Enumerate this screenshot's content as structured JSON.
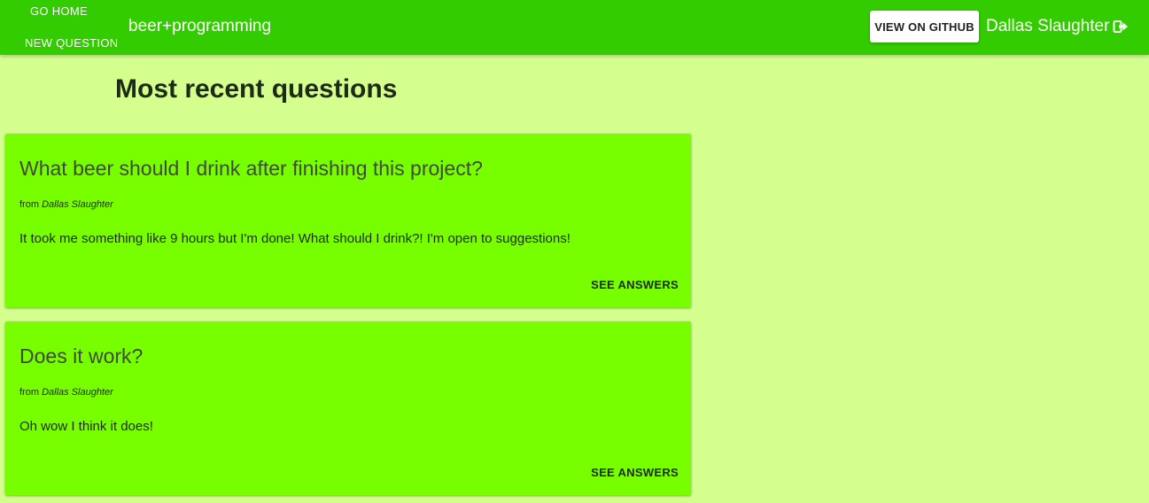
{
  "nav": {
    "home_label": "GO HOME",
    "new_question_label": "NEW QUESTION",
    "brand": "beer+programming",
    "github_label": "VIEW ON GITHUB",
    "user_name": "Dallas Slaughter",
    "logout_icon": "sign-out-icon"
  },
  "page": {
    "heading": "Most recent questions"
  },
  "questions": [
    {
      "title": "What beer should I drink after finishing this project?",
      "from_prefix": "from",
      "author": "Dallas Slaughter",
      "body": "It took me something like 9 hours but I'm done! What should I drink?! I'm open to suggestions!",
      "action_label": "SEE ANSWERS"
    },
    {
      "title": "Does it work?",
      "from_prefix": "from",
      "author": "Dallas Slaughter",
      "body": "Oh wow I think it does!",
      "action_label": "SEE ANSWERS"
    }
  ],
  "colors": {
    "appbar": "#33cc00",
    "background": "#d4ff8f",
    "card": "#77ff00"
  }
}
